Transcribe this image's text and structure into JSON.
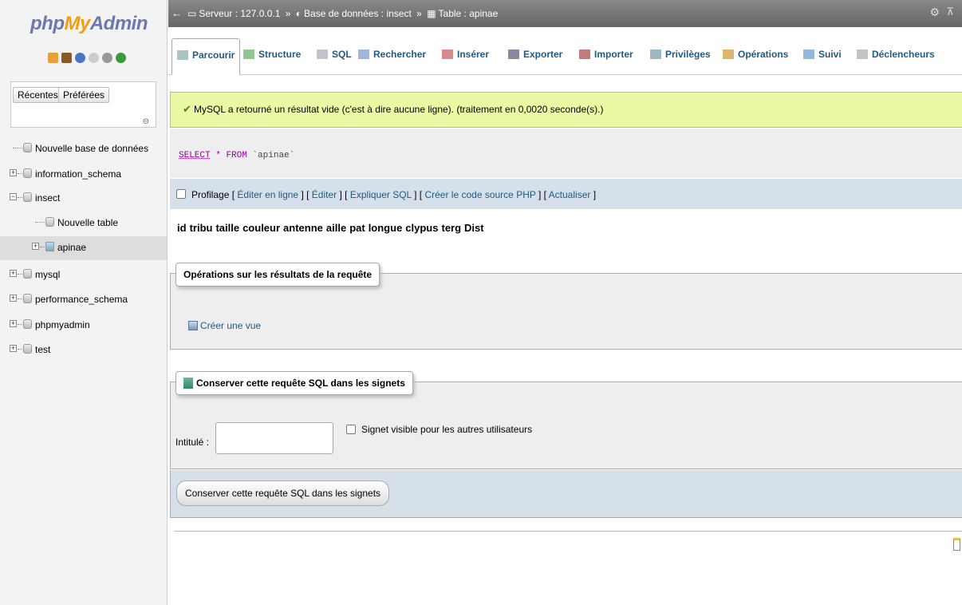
{
  "nav": {
    "logo": {
      "php": "php",
      "my": "My",
      "admin": "Admin"
    },
    "quick_icons": [
      "home-icon",
      "logout-icon",
      "help-icon",
      "docs-icon",
      "settings-icon",
      "reload-icon"
    ],
    "tabs": {
      "recent": "Récentes",
      "favorites": "Préférées"
    },
    "link_icon": "⊝",
    "tree": [
      {
        "label": "Nouvelle base de données",
        "level": 0,
        "type": "new"
      },
      {
        "label": "information_schema",
        "level": 0,
        "type": "db"
      },
      {
        "label": "insect",
        "level": 0,
        "type": "db",
        "expanded": true
      },
      {
        "label": "Nouvelle table",
        "level": 1,
        "type": "new"
      },
      {
        "label": "apinae",
        "level": 1,
        "type": "table",
        "selected": true
      },
      {
        "label": "mysql",
        "level": 0,
        "type": "db"
      },
      {
        "label": "performance_schema",
        "level": 0,
        "type": "db"
      },
      {
        "label": "phpmyadmin",
        "level": 0,
        "type": "db"
      },
      {
        "label": "test",
        "level": 0,
        "type": "db"
      }
    ]
  },
  "topbar": {
    "server": "Serveur : 127.0.0.1",
    "sep": "»",
    "database": "Base de données : insect",
    "table": "Table : apinae"
  },
  "menu": {
    "tabs": [
      {
        "label": "Parcourir",
        "icon": "browse-icon",
        "active": true
      },
      {
        "label": "Structure",
        "icon": "structure-icon"
      },
      {
        "label": "SQL",
        "icon": "sql-icon"
      },
      {
        "label": "Rechercher",
        "icon": "search-icon"
      },
      {
        "label": "Insérer",
        "icon": "insert-icon"
      },
      {
        "label": "Exporter",
        "icon": "export-icon"
      },
      {
        "label": "Importer",
        "icon": "import-icon"
      },
      {
        "label": "Privilèges",
        "icon": "privileges-icon"
      },
      {
        "label": "Opérations",
        "icon": "operations-icon"
      },
      {
        "label": "Suivi",
        "icon": "tracking-icon"
      },
      {
        "label": "Déclencheurs",
        "icon": "triggers-icon"
      }
    ]
  },
  "result": {
    "message": "MySQL a retourné un résultat vide (c'est à dire aucune ligne). (traitement en 0,0020 seconde(s).)",
    "query": {
      "select": "SELECT",
      "star": "*",
      "from": "FROM",
      "table": "`apinae`"
    },
    "profiling": "Profilage",
    "links": [
      "Éditer en ligne",
      "Éditer",
      "Expliquer SQL",
      "Créer le code source PHP",
      "Actualiser"
    ],
    "columns": [
      "id",
      "tribu",
      "taille",
      "couleur",
      "antenne",
      "aille",
      "pat",
      "longue",
      "clypus",
      "terg",
      "Dist"
    ]
  },
  "ops": {
    "legend": "Opérations sur les résultats de la requête",
    "create_view": "Créer une vue"
  },
  "bookmark": {
    "legend": "Conserver cette requête SQL dans les signets",
    "label": "Intitulé :",
    "visible_checkbox": "Signet visible pour les autres utilisateurs",
    "submit": "Conserver cette requête SQL dans les signets"
  },
  "colors": {
    "accent": "#235a81",
    "success_bg": "#ebf8a4",
    "topbar": "#777777"
  }
}
